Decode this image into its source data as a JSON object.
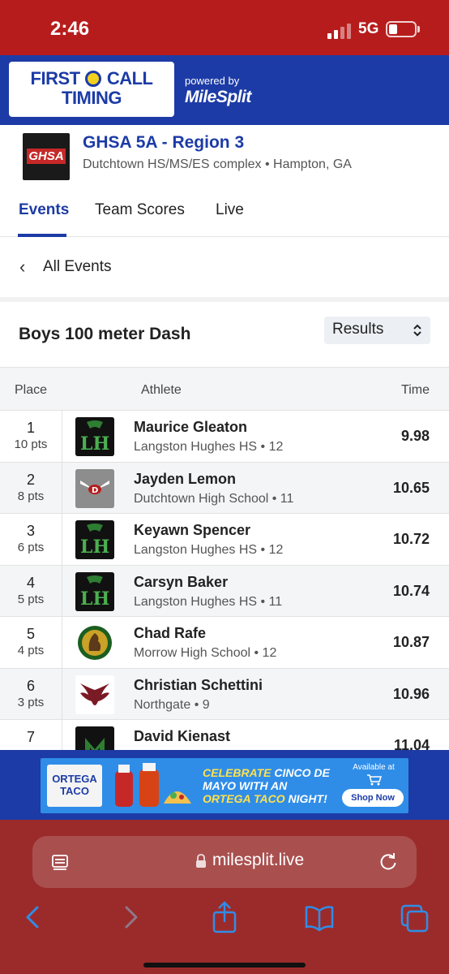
{
  "status_bar": {
    "time": "2:46",
    "network": "5G"
  },
  "brand": {
    "logo_line1": "FIRST",
    "logo_line1b": "CALL",
    "logo_line2": "TIMING",
    "powered_by": "powered by",
    "partner": "MileSplit"
  },
  "meet": {
    "logo_text": "GHSA",
    "title": "GHSA 5A - Region 3",
    "subtitle": "Dutchtown HS/MS/ES complex • Hampton, GA"
  },
  "tabs": [
    {
      "label": "Events",
      "active": true
    },
    {
      "label": "Team Scores",
      "active": false
    },
    {
      "label": "Live",
      "active": false
    }
  ],
  "back_link": {
    "label": "All Events"
  },
  "event": {
    "title": "Boys 100 meter Dash",
    "view_select": "Results"
  },
  "table": {
    "headers": {
      "place": "Place",
      "athlete": "Athlete",
      "time": "Time"
    },
    "rows": [
      {
        "place": "1",
        "points": "10 pts",
        "name": "Maurice Gleaton",
        "school": "Langston Hughes HS • 12",
        "time": "9.98",
        "logo": "langston-hughes-logo"
      },
      {
        "place": "2",
        "points": "8 pts",
        "name": "Jayden Lemon",
        "school": "Dutchtown High School • 11",
        "time": "10.65",
        "logo": "dutchtown-logo"
      },
      {
        "place": "3",
        "points": "6 pts",
        "name": "Keyawn Spencer",
        "school": "Langston Hughes HS • 12",
        "time": "10.72",
        "logo": "langston-hughes-logo"
      },
      {
        "place": "4",
        "points": "5 pts",
        "name": "Carsyn Baker",
        "school": "Langston Hughes HS • 11",
        "time": "10.74",
        "logo": "langston-hughes-logo"
      },
      {
        "place": "5",
        "points": "4 pts",
        "name": "Chad Rafe",
        "school": "Morrow High School • 12",
        "time": "10.87",
        "logo": "morrow-logo"
      },
      {
        "place": "6",
        "points": "3 pts",
        "name": "Christian Schettini",
        "school": "Northgate • 9",
        "time": "10.96",
        "logo": "northgate-logo"
      },
      {
        "place": "7",
        "points": "",
        "name": "David Kienast",
        "school": "",
        "time": "11.04",
        "logo": "cross-country-logo"
      }
    ]
  },
  "ad": {
    "brand": "ORTEGA",
    "brand_sub": "TACO",
    "headline_1": "CELEBRATE",
    "headline_2": "CINCO DE MAYO WITH AN",
    "headline_3": "ORTEGA TACO",
    "headline_4": "NIGHT!",
    "available": "Available at",
    "cta": "Shop Now"
  },
  "browser": {
    "url": "milesplit.live"
  },
  "colors": {
    "status_red": "#b71c1c",
    "brand_blue": "#1c3ba6",
    "browser_red": "#9b2b2b"
  }
}
